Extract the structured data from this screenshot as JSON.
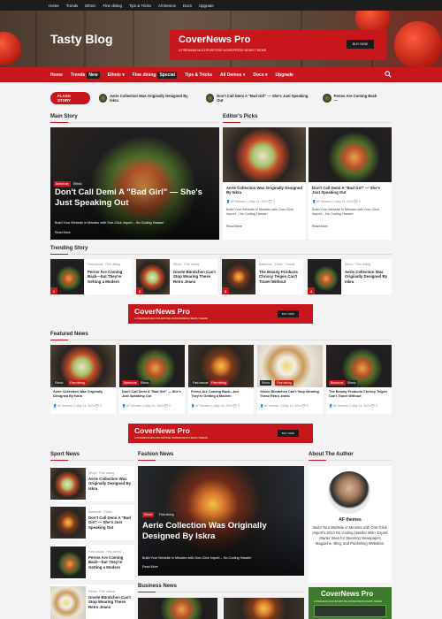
{
  "topbar": {
    "items": [
      "Home",
      "Trends",
      "Ethnic",
      "Fine dining",
      "Tips & Tricks",
      "All Demos",
      "Docs",
      "Upgrade"
    ]
  },
  "site": {
    "title": "Tasty Blog"
  },
  "header_ad": {
    "title": "CoverNews Pro",
    "subtitle": "A PREMIUM MULTIPURPOSE WORDPRESS NEWS THEME",
    "button": "BUY NOW"
  },
  "nav": {
    "items": [
      {
        "label": "Home",
        "badge": ""
      },
      {
        "label": "Trends",
        "badge": "New"
      },
      {
        "label": "Ethnic ▾",
        "badge": ""
      },
      {
        "label": "Fine dining",
        "badge": "Special"
      },
      {
        "label": "Tips & Tricks",
        "badge": ""
      },
      {
        "label": "All Demos ▾",
        "badge": ""
      },
      {
        "label": "Docs ▾",
        "badge": ""
      },
      {
        "label": "Upgrade",
        "badge": ""
      }
    ]
  },
  "flash": {
    "label": "FLASH STORY",
    "items": [
      "Aerie Collection Was Originally Designed By Iskra",
      "Don't Call Demi A \"Bad Girl\" — She's Just Speaking Out",
      "Perms Are Coming Back—"
    ]
  },
  "sections": {
    "main_story": "Main Story",
    "editors_picks": "Editor's Picks",
    "trending": "Trending Story",
    "featured": "Featured News",
    "sport": "Sport News",
    "fashion": "Fashion News",
    "about": "About The Author",
    "business": "Business News"
  },
  "main_story": {
    "tags": [
      "Barbecue",
      "Ethnic"
    ],
    "title": "Don't Call Demi A \"Bad Girl\" — She's Just Speaking Out",
    "excerpt": "Build Your Website in Minutes with One-Click Import – No Coding Hassle!",
    "read_more": "Read More"
  },
  "editors": [
    {
      "title": "Aerie Collection Was Originally Designed By Iskra",
      "author": "AF themes",
      "date": "May 14, 2024",
      "comments": "0",
      "excerpt": "Build Your Website in Minutes with One-Click Import – No Coding Hassle!",
      "read_more": "Read More"
    },
    {
      "title": "Don't Call Demi A \"Bad Girl\" — She's Just Speaking Out",
      "author": "AF themes",
      "date": "May 14, 2024",
      "comments": "0",
      "excerpt": "Build Your Website in Minutes with One-Click Import – No Coding Hassle!",
      "read_more": "Read More"
    }
  ],
  "trending": [
    {
      "n": "1",
      "cats": "Fast casual · Fine dining",
      "title": "Perms Are Coming Back—but They're Getting a Modern"
    },
    {
      "n": "2",
      "cats": "Ethnic · Fine dining",
      "title": "Gisele Bündchen Can't Stop Wearing These Retro Jeans"
    },
    {
      "n": "3",
      "cats": "Barbecue · Ethnic · Trends",
      "title": "The Beauty Products Chrissy Teigen Can't Travel Without"
    },
    {
      "n": "4",
      "cats": "Ethnic · Fine dining",
      "title": "Aerie Collection Was Originally Designed By Iskra"
    }
  ],
  "mid_ad": {
    "title": "CoverNews Pro",
    "subtitle": "A PREMIUM MULTIPURPOSE WORDPRESS NEWS THEME",
    "button": "BUY NOW"
  },
  "featured": [
    {
      "tags": [
        "Ethnic",
        "Fine dining"
      ],
      "title": "Aerie Collection Was Originally Designed By Iskra",
      "author": "AF themes",
      "date": "May 14, 2024",
      "comments": "0"
    },
    {
      "tags": [
        "Barbecue",
        "Ethnic"
      ],
      "title": "Don't Call Demi A \"Bad Girl\" — She's Just Speaking Out",
      "author": "AF themes",
      "date": "May 14, 2024",
      "comments": "0"
    },
    {
      "tags": [
        "Fast casual",
        "Fine dining"
      ],
      "title": "Perms Are Coming Back—but They're Getting a Modern",
      "author": "AF themes",
      "date": "May 14, 2024",
      "comments": "0"
    },
    {
      "tags": [
        "Ethnic",
        "Fine dining"
      ],
      "title": "Gisele Bündchen Can't Stop Wearing These Retro Jeans",
      "author": "AF themes",
      "date": "May 14, 2024",
      "comments": "0"
    },
    {
      "tags": [
        "Barbecue",
        "Ethnic"
      ],
      "title": "The Beauty Products Chrissy Teigen Can't Travel Without",
      "author": "AF themes",
      "date": "May 14, 2024",
      "comments": "0"
    }
  ],
  "sport": [
    {
      "cats": "Ethnic · Fine dining",
      "title": "Aerie Collection Was Originally Designed By Iskra"
    },
    {
      "cats": "Barbecue · Ethnic",
      "title": "Don't Call Demi A \"Bad Girl\" — She's Just Speaking Out"
    },
    {
      "cats": "Fast casual · Fine dining",
      "title": "Perms Are Coming Back—but They're Getting a Modern"
    },
    {
      "cats": "Ethnic · Fast casual",
      "title": "Gisele Bündchen Can't Stop Wearing These Retro Jeans"
    }
  ],
  "fashion": {
    "tags": [
      "Ethnic",
      "Fine dining"
    ],
    "title": "Aerie Collection Was Originally Designed By Iskra",
    "excerpt": "Build Your Website in Minutes with One-Click Import – No Coding Hassle!",
    "read_more": "Read More"
  },
  "about": {
    "name": "AF themes",
    "bio": "Build Your Website in Minutes with One-Click Import's 2013 No Coding Hassle! 365+ Expert Starter Sites for Stunning Newspaper, Magazine, Blog, and Publishing Websites."
  },
  "side_ad": {
    "title": "CoverNews Pro",
    "subtitle": "A PREMIUM MULTIPURPOSE WORDPRESS NEWS THEME"
  },
  "colors": {
    "accent": "#c8161d",
    "dark": "#1c1c1c"
  }
}
